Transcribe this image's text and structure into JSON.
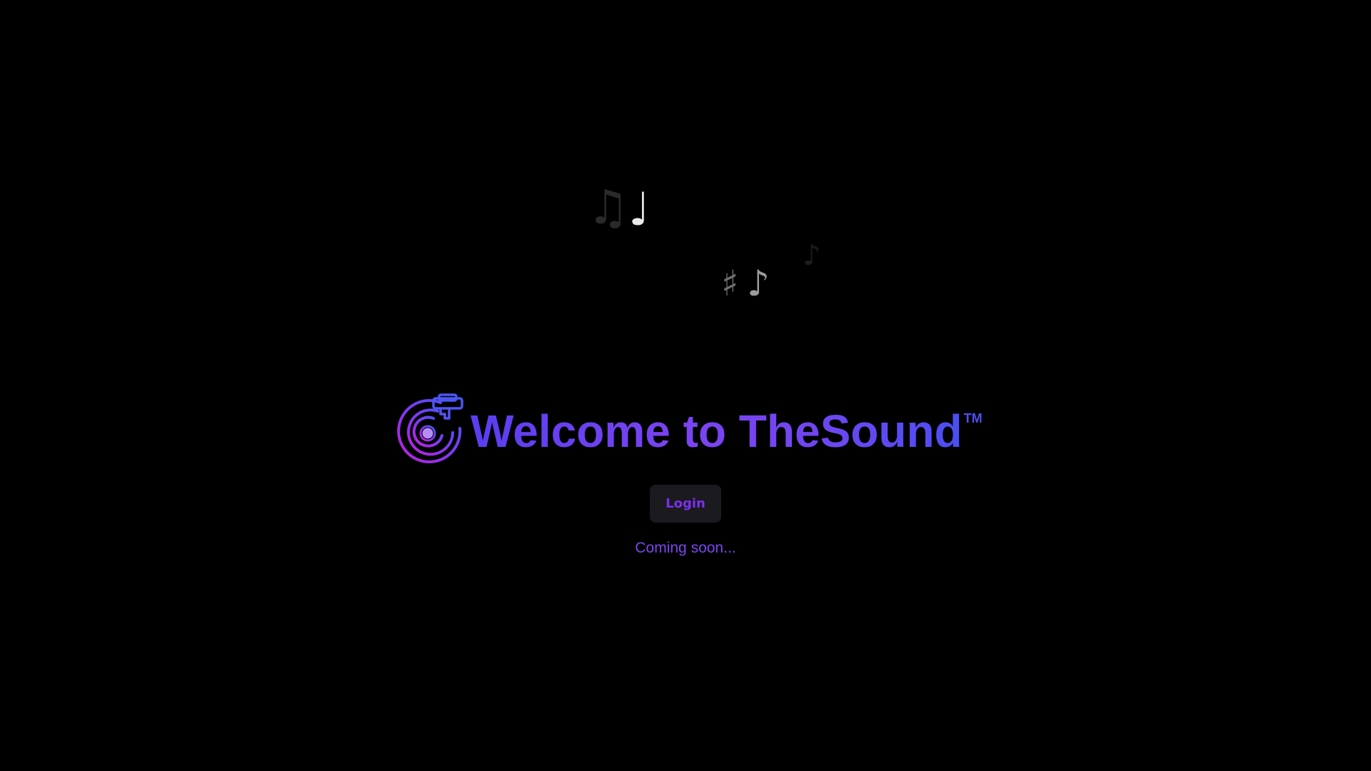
{
  "decorations": {
    "notes": [
      {
        "icon": "beamed-eighth-notes-icon",
        "glyph": "♫"
      },
      {
        "icon": "quarter-note-icon",
        "glyph": "♩"
      },
      {
        "icon": "eighth-note-icon",
        "glyph": "♪"
      },
      {
        "icon": "sharp-icon",
        "glyph": "♯"
      },
      {
        "icon": "eighth-note-icon",
        "glyph": "♪"
      }
    ]
  },
  "hero": {
    "logo_icon": "vinyl-record-player-icon",
    "title": "Welcome to TheSound",
    "trademark": "TM"
  },
  "login": {
    "label": "Login"
  },
  "status": {
    "text": "Coming soon..."
  },
  "colors": {
    "background": "#000000",
    "accent_purple": "#7b2ff0",
    "accent_blue": "#4b4ef2",
    "button_bg": "#1b1a1e"
  }
}
